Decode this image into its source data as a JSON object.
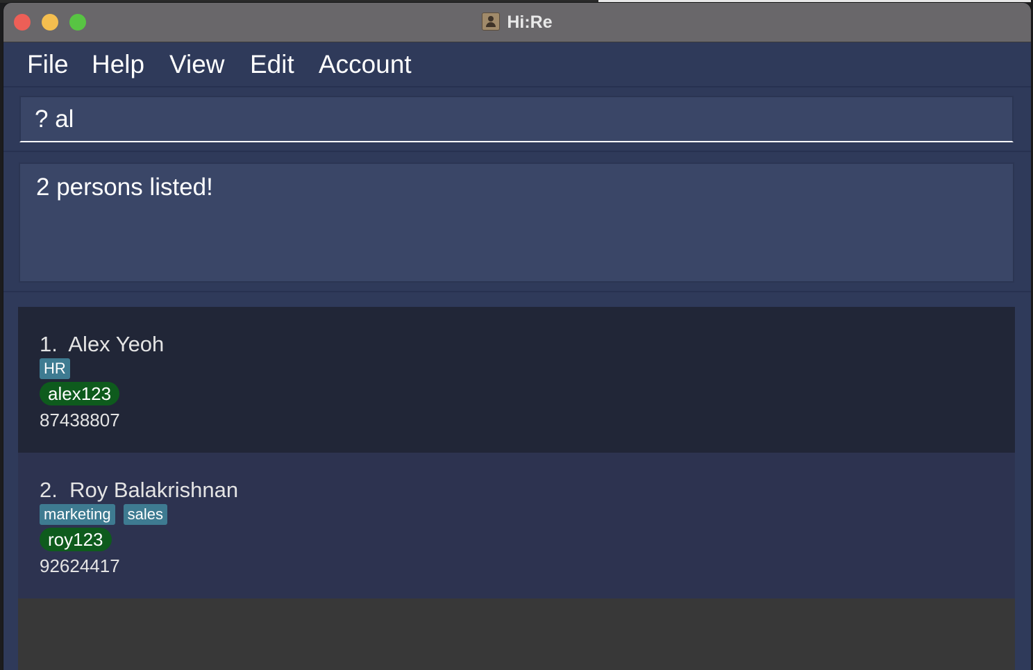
{
  "window": {
    "title": "Hi:Re"
  },
  "menu": {
    "items": [
      "File",
      "Help",
      "View",
      "Edit",
      "Account"
    ]
  },
  "command": {
    "value": "? al"
  },
  "result": {
    "message": "2 persons listed!"
  },
  "persons": [
    {
      "index": "1.",
      "name": "Alex Yeoh",
      "tags": [
        "HR"
      ],
      "username": "alex123",
      "phone": "87438807"
    },
    {
      "index": "2.",
      "name": "Roy Balakrishnan",
      "tags": [
        "marketing",
        "sales"
      ],
      "username": "roy123",
      "phone": "92624417"
    }
  ],
  "colors": {
    "window_bg": "#2f3a5a",
    "titlebar": "#69676a",
    "card_odd": "#212637",
    "card_even": "#2d3350",
    "tag": "#3e7b91",
    "username_pill": "#0e5b1d",
    "close": "#ed5f57",
    "minimize": "#f4be4f",
    "maximize": "#58c443"
  }
}
